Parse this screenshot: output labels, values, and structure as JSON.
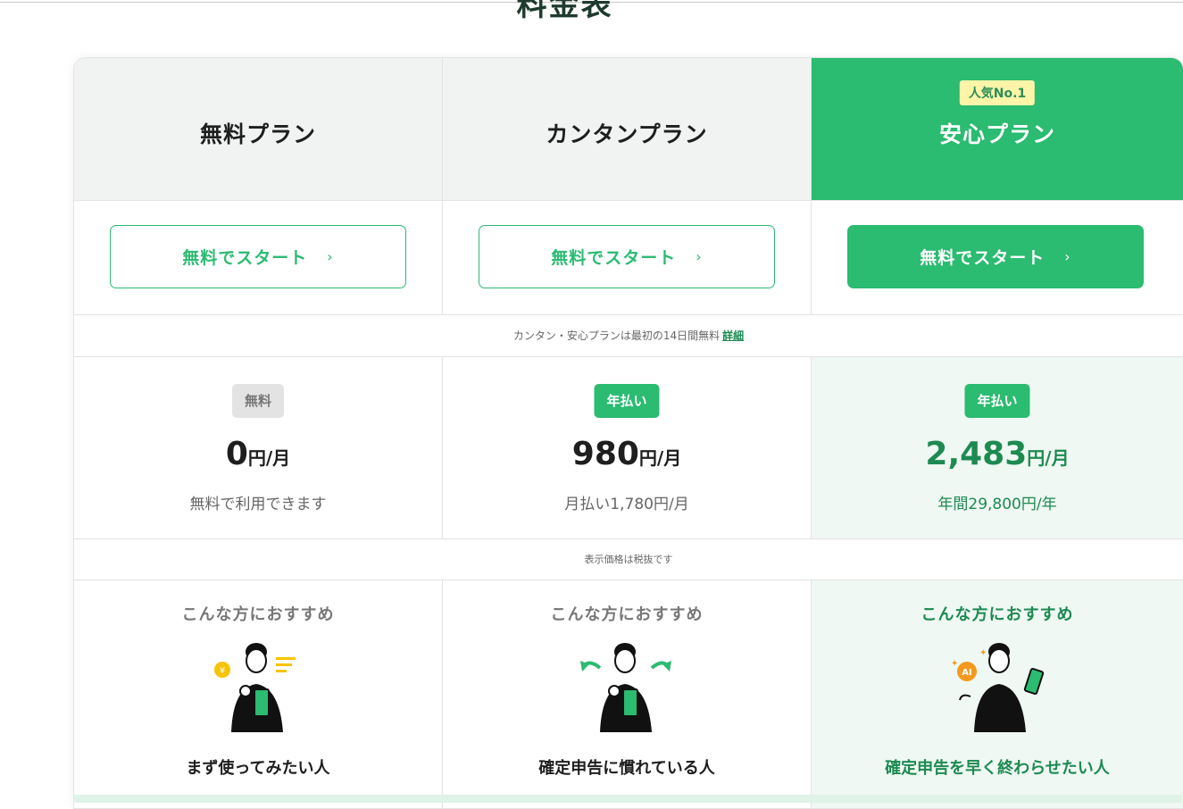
{
  "page_title": "料金表",
  "plans": [
    {
      "name": "無料プラン"
    },
    {
      "name": "カンタンプラン"
    },
    {
      "name": "安心プラン",
      "badge": "人気No.1"
    }
  ],
  "start_button_label": "無料でスタート",
  "trial_note": "カンタン・安心プランは最初の14日間無料",
  "trial_link": "詳細",
  "prices": [
    {
      "tag": "無料",
      "amount": "0",
      "unit": "円/月",
      "sub": "無料で利用できます"
    },
    {
      "tag": "年払い",
      "amount": "980",
      "unit": "円/月",
      "sub": "月払い1,780円/月"
    },
    {
      "tag": "年払い",
      "amount": "2,483",
      "unit": "円/月",
      "sub": "年間29,800円/年"
    }
  ],
  "tax_note": "表示価格は税抜です",
  "recommend_title": "こんな方におすすめ",
  "recommend": [
    {
      "who": "まず使ってみたい人"
    },
    {
      "who": "確定申告に慣れている人"
    },
    {
      "who": "確定申告を早く終わらせたい人"
    }
  ],
  "ai_badge": "AI",
  "yen_symbol": "¥",
  "colors": {
    "accent": "#2bbb71",
    "accent_dark": "#1d8a52",
    "header_gray": "#f1f3f2",
    "badge_yellow": "#fff4a8"
  }
}
